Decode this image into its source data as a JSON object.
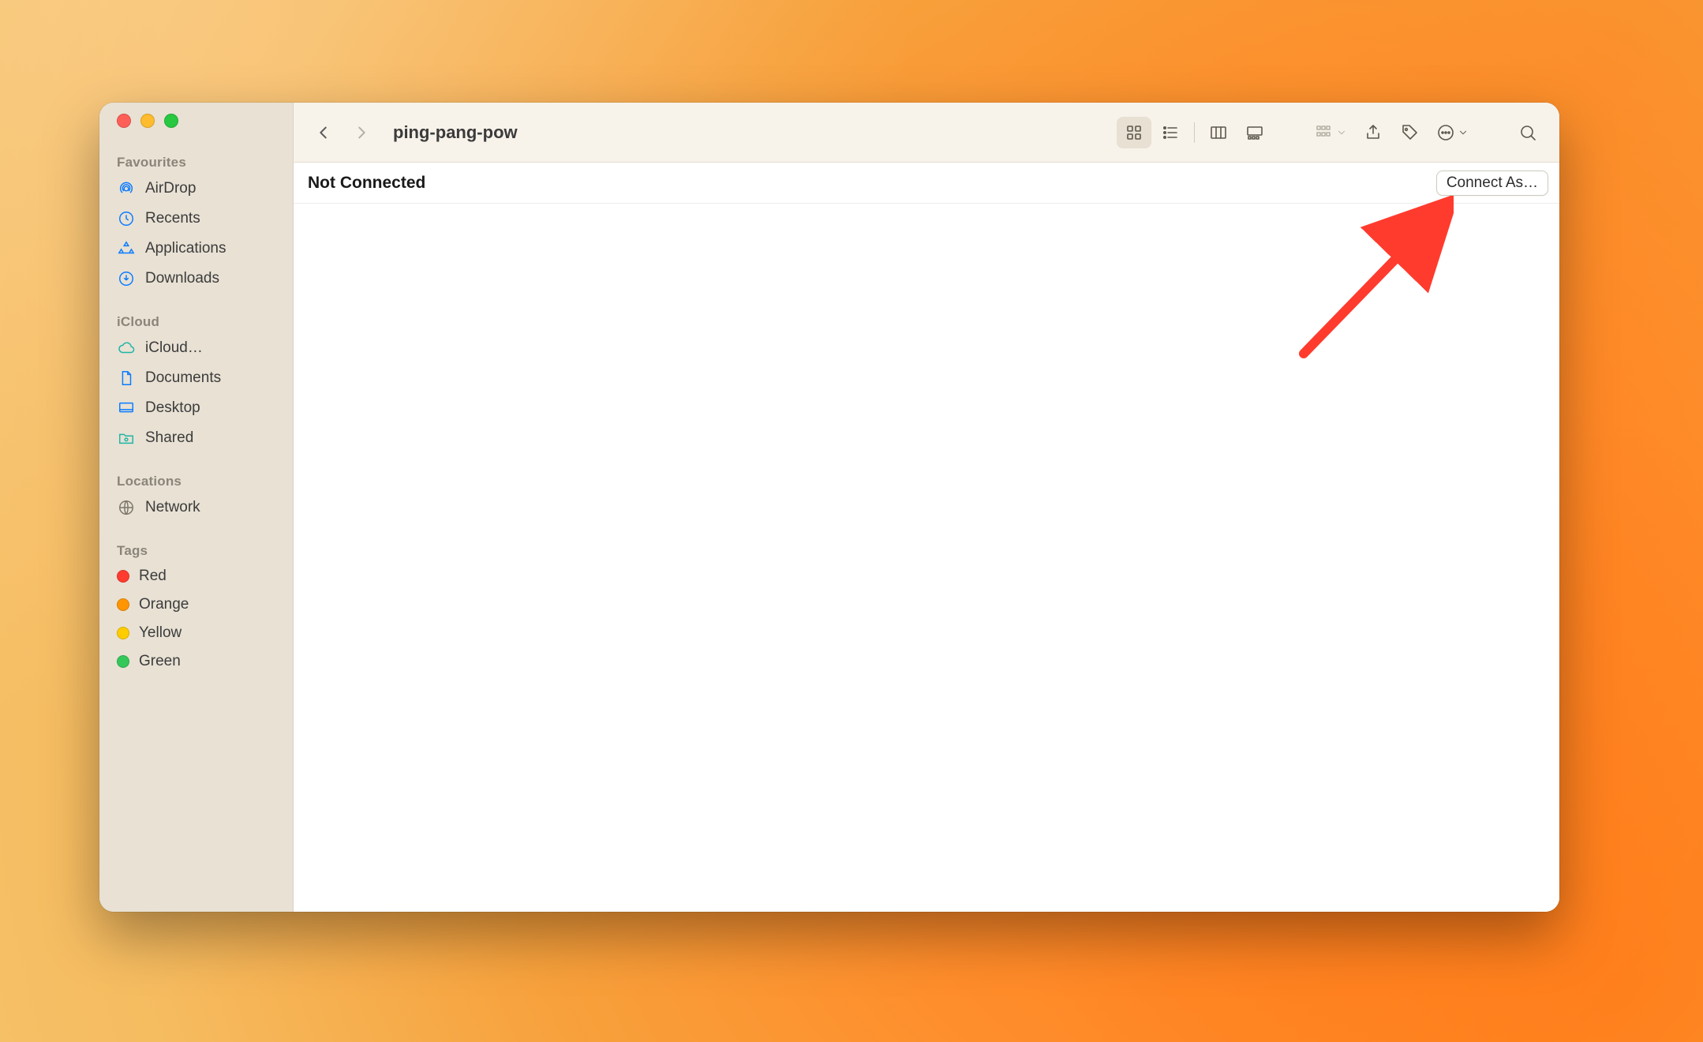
{
  "window": {
    "title": "ping-pang-pow"
  },
  "sidebar": {
    "sections": {
      "favourites": {
        "header": "Favourites",
        "items": [
          {
            "label": "AirDrop"
          },
          {
            "label": "Recents"
          },
          {
            "label": "Applications"
          },
          {
            "label": "Downloads"
          }
        ]
      },
      "icloud": {
        "header": "iCloud",
        "items": [
          {
            "label": "iCloud…"
          },
          {
            "label": "Documents"
          },
          {
            "label": "Desktop"
          },
          {
            "label": "Shared"
          }
        ]
      },
      "locations": {
        "header": "Locations",
        "items": [
          {
            "label": "Network"
          }
        ]
      },
      "tags": {
        "header": "Tags",
        "items": [
          {
            "label": "Red"
          },
          {
            "label": "Orange"
          },
          {
            "label": "Yellow"
          },
          {
            "label": "Green"
          }
        ]
      }
    }
  },
  "status": {
    "text": "Not Connected",
    "connect_label": "Connect As…"
  }
}
